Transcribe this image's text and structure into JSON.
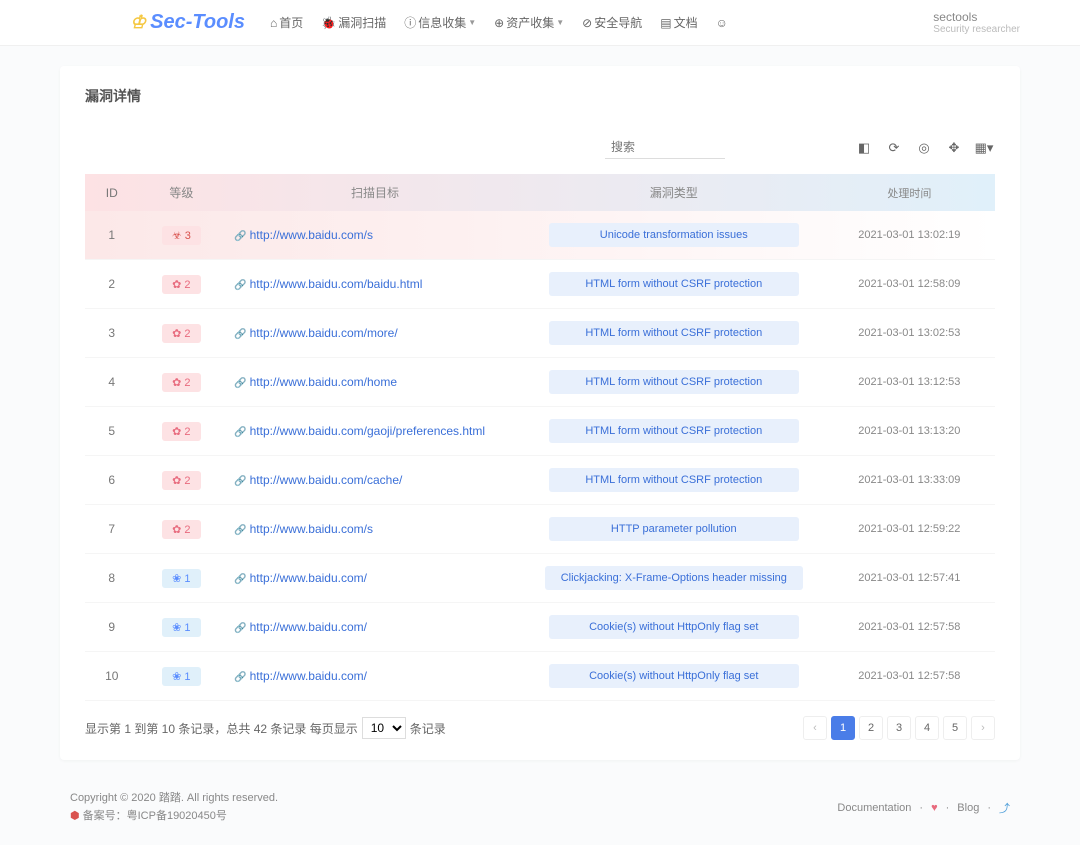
{
  "brand": "Sec-Tools",
  "nav": {
    "items": [
      {
        "label": "首页"
      },
      {
        "label": "漏洞扫描"
      },
      {
        "label": "信息收集",
        "dropdown": true
      },
      {
        "label": "资产收集",
        "dropdown": true
      },
      {
        "label": "安全导航"
      },
      {
        "label": "文档"
      }
    ]
  },
  "user": {
    "name": "sectools",
    "sub": "Security researcher"
  },
  "page": {
    "title": "漏洞详情"
  },
  "search": {
    "placeholder": "搜索"
  },
  "table": {
    "headers": {
      "id": "ID",
      "severity": "等级",
      "target": "扫描目标",
      "type": "漏洞类型",
      "time": "处理时间"
    },
    "rows": [
      {
        "id": "1",
        "sev": "3",
        "sev_class": "sev-3",
        "sev_icon": "☣",
        "target": "http://www.baidu.com/s",
        "type": "Unicode transformation issues",
        "time": "2021-03-01 13:02:19"
      },
      {
        "id": "2",
        "sev": "2",
        "sev_class": "sev-2",
        "sev_icon": "✿",
        "target": "http://www.baidu.com/baidu.html",
        "type": "HTML form without CSRF protection",
        "time": "2021-03-01 12:58:09"
      },
      {
        "id": "3",
        "sev": "2",
        "sev_class": "sev-2",
        "sev_icon": "✿",
        "target": "http://www.baidu.com/more/",
        "type": "HTML form without CSRF protection",
        "time": "2021-03-01 13:02:53"
      },
      {
        "id": "4",
        "sev": "2",
        "sev_class": "sev-2",
        "sev_icon": "✿",
        "target": "http://www.baidu.com/home",
        "type": "HTML form without CSRF protection",
        "time": "2021-03-01 13:12:53"
      },
      {
        "id": "5",
        "sev": "2",
        "sev_class": "sev-2",
        "sev_icon": "✿",
        "target": "http://www.baidu.com/gaoji/preferences.html",
        "type": "HTML form without CSRF protection",
        "time": "2021-03-01 13:13:20"
      },
      {
        "id": "6",
        "sev": "2",
        "sev_class": "sev-2",
        "sev_icon": "✿",
        "target": "http://www.baidu.com/cache/",
        "type": "HTML form without CSRF protection",
        "time": "2021-03-01 13:33:09"
      },
      {
        "id": "7",
        "sev": "2",
        "sev_class": "sev-2",
        "sev_icon": "✿",
        "target": "http://www.baidu.com/s",
        "type": "HTTP parameter pollution",
        "time": "2021-03-01 12:59:22"
      },
      {
        "id": "8",
        "sev": "1",
        "sev_class": "sev-1",
        "sev_icon": "❀",
        "target": "http://www.baidu.com/",
        "type": "Clickjacking: X-Frame-Options header missing",
        "time": "2021-03-01 12:57:41"
      },
      {
        "id": "9",
        "sev": "1",
        "sev_class": "sev-1",
        "sev_icon": "❀",
        "target": "http://www.baidu.com/",
        "type": "Cookie(s) without HttpOnly flag set",
        "time": "2021-03-01 12:57:58"
      },
      {
        "id": "10",
        "sev": "1",
        "sev_class": "sev-1",
        "sev_icon": "❀",
        "target": "http://www.baidu.com/",
        "type": "Cookie(s) without HttpOnly flag set",
        "time": "2021-03-01 12:57:58"
      }
    ]
  },
  "pager": {
    "info_prefix": "显示第 1 到第 10 条记录，总共 42 条记录 每页显示",
    "info_suffix": "条记录",
    "page_size": "10",
    "pages": [
      "1",
      "2",
      "3",
      "4",
      "5"
    ],
    "current": "1"
  },
  "footer": {
    "copyright": "Copyright © 2020 踏踏. All rights reserved.",
    "beian": "备案号：粤ICP备19020450号",
    "doc": "Documentation",
    "blog": "Blog"
  }
}
